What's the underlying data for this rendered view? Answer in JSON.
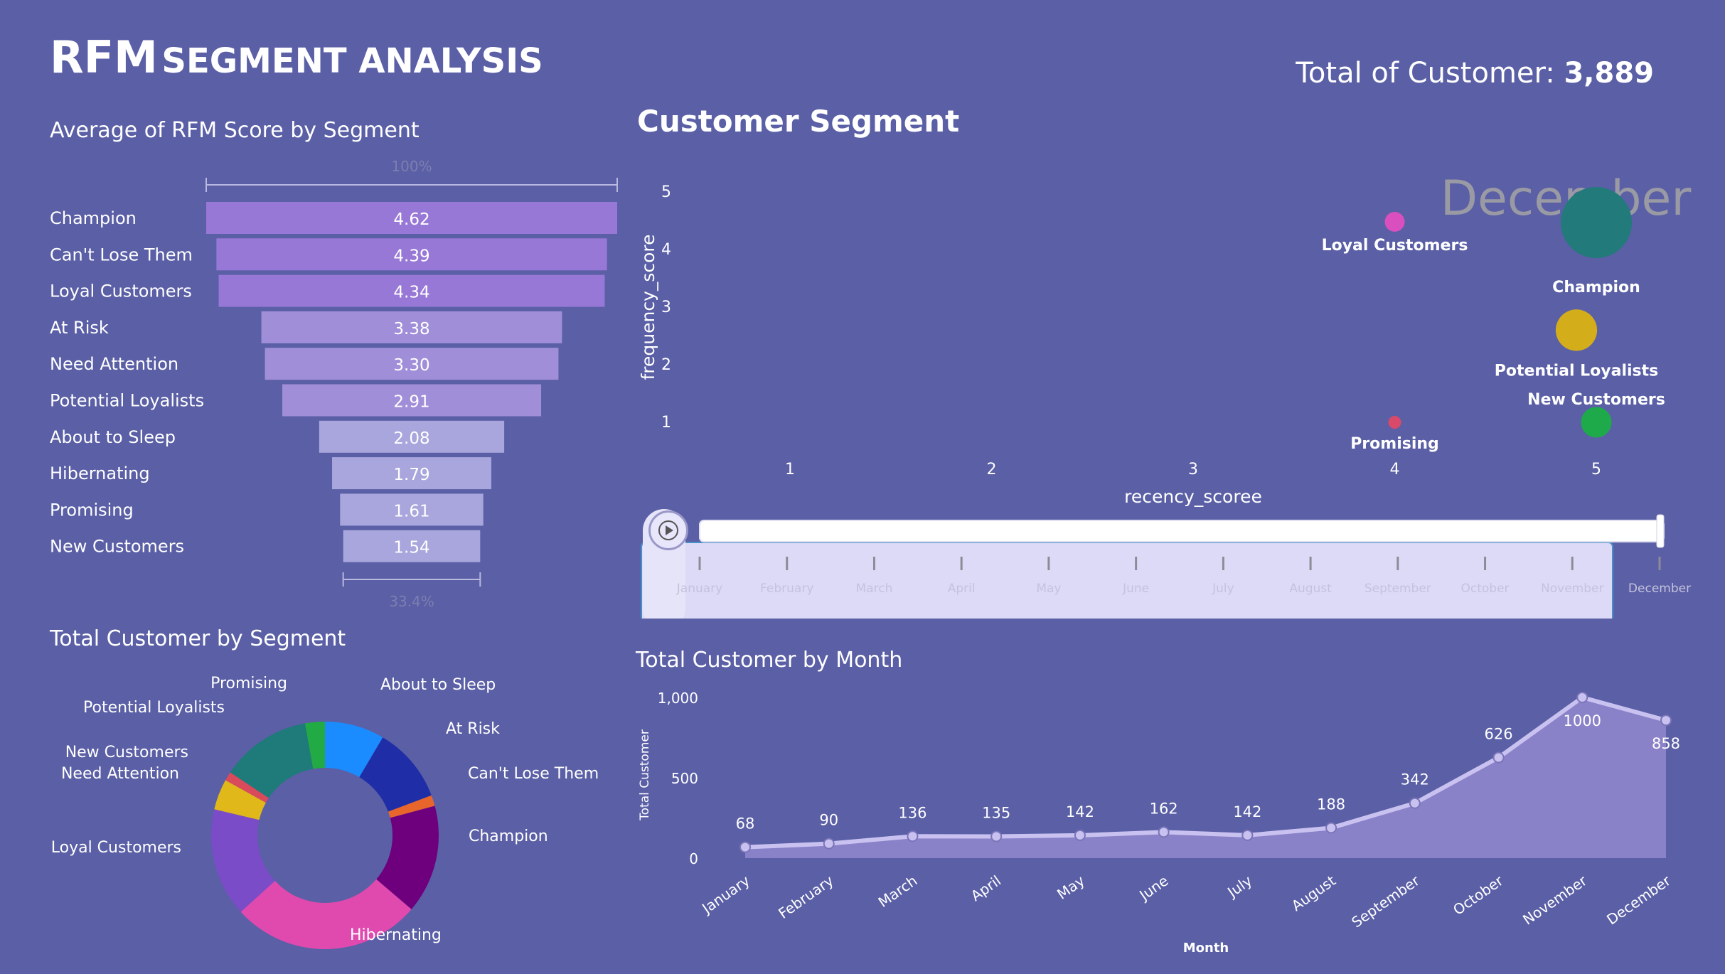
{
  "header": {
    "title_big": "RFM",
    "title_small": "SEGMENT ANALYSIS",
    "total_label": "Total of Customer: ",
    "total_value": "3,889"
  },
  "funnel": {
    "title": "Average of RFM Score by Segment",
    "top_pct": "100%",
    "bottom_pct": "33.4%"
  },
  "bubble": {
    "title": "Customer Segment",
    "play_label": "December"
  },
  "donut": {
    "title": "Total Customer by Segment"
  },
  "line": {
    "title": "Total Customer by Month"
  },
  "colors": {
    "background": "#5a5fa6",
    "funnel_dark": "#9878d6",
    "funnel_light": "#a8a6dc",
    "line": "#c9c2f0",
    "area": "#8a82c8",
    "slider_panel": "#dcdaf6"
  },
  "chart_data": [
    {
      "type": "bar",
      "subtype": "funnel",
      "title": "Average of RFM Score by Segment",
      "categories": [
        "Champion",
        "Can't Lose Them",
        "Loyal Customers",
        "At Risk",
        "Need Attention",
        "Potential Loyalists",
        "About to Sleep",
        "Hibernating",
        "Promising",
        "New Customers"
      ],
      "values": [
        4.62,
        4.39,
        4.34,
        3.38,
        3.3,
        2.91,
        2.08,
        1.79,
        1.61,
        1.54
      ],
      "labels": [
        "4.62",
        "4.39",
        "4.34",
        "3.38",
        "3.30",
        "2.91",
        "2.08",
        "1.79",
        "1.61",
        "1.54"
      ]
    },
    {
      "type": "scatter",
      "subtype": "bubble",
      "title": "Customer Segment",
      "xlabel": "recency_scoree",
      "ylabel": "frequency_score",
      "xlim": [
        0.5,
        5.5
      ],
      "ylim": [
        0.5,
        5.5
      ],
      "xticks": [
        "1",
        "2",
        "3",
        "4",
        "5"
      ],
      "yticks": [
        "1",
        "2",
        "3",
        "4",
        "5"
      ],
      "play_axis": "December",
      "slider_ticks": [
        "January",
        "February",
        "March",
        "April",
        "May",
        "June",
        "July",
        "August",
        "September",
        "October",
        "November",
        "December"
      ],
      "points": [
        {
          "name": "Loyal Customers",
          "x": 4,
          "y": 4.5,
          "size": 0.2,
          "color": "#d94fbf"
        },
        {
          "name": "Champion",
          "x": 5,
          "y": 4.5,
          "size": 1.0,
          "color": "#227a7a"
        },
        {
          "name": "Potential Loyalists",
          "x": 5,
          "y": 2.6,
          "size": 0.45,
          "color": "#d4ad1a"
        },
        {
          "name": "New Customers",
          "x": 5,
          "y": 1,
          "size": 0.25,
          "color": "#1eaa4a"
        },
        {
          "name": "Promising",
          "x": 4,
          "y": 1,
          "size": 0.1,
          "color": "#d94a6a"
        }
      ]
    },
    {
      "type": "pie",
      "subtype": "donut",
      "title": "Total Customer by Segment",
      "slices": [
        {
          "name": "About to Sleep",
          "value": 330,
          "color": "#1a8cff"
        },
        {
          "name": "At Risk",
          "value": 420,
          "color": "#1f2ea6"
        },
        {
          "name": "Can't Lose Them",
          "value": 60,
          "color": "#e8662b"
        },
        {
          "name": "Champion",
          "value": 600,
          "color": "#6e007d"
        },
        {
          "name": "Hibernating",
          "value": 1050,
          "color": "#e04aaf"
        },
        {
          "name": "Loyal Customers",
          "value": 600,
          "color": "#7a4cc8"
        },
        {
          "name": "Need Attention",
          "value": 170,
          "color": "#e0b81a"
        },
        {
          "name": "New Customers",
          "value": 50,
          "color": "#d94a5a"
        },
        {
          "name": "Potential Loyalists",
          "value": 500,
          "color": "#1f7a7a"
        },
        {
          "name": "Promising",
          "value": 109,
          "color": "#22aa44"
        }
      ]
    },
    {
      "type": "area",
      "title": "Total Customer by Month",
      "xlabel": "Month",
      "ylabel": "Total Customer",
      "ylim": [
        0,
        1000
      ],
      "yticks": [
        "0",
        "500",
        "1,000"
      ],
      "categories": [
        "January",
        "February",
        "March",
        "April",
        "May",
        "June",
        "July",
        "August",
        "September",
        "October",
        "November",
        "December"
      ],
      "values": [
        68,
        90,
        136,
        135,
        142,
        162,
        142,
        188,
        342,
        626,
        1000,
        858
      ],
      "labels": [
        "68",
        "90",
        "136",
        "135",
        "142",
        "162",
        "142",
        "188",
        "342",
        "626",
        "1000",
        "858"
      ]
    }
  ]
}
